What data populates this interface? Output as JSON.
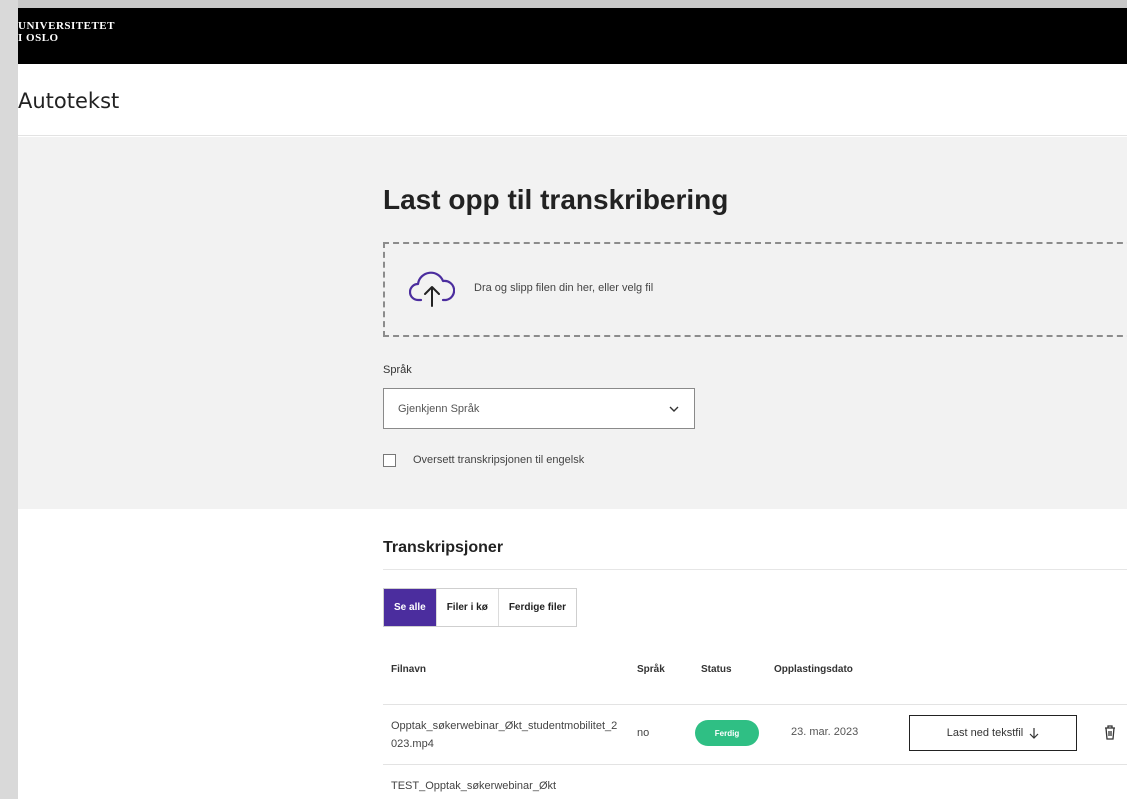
{
  "topbar": {
    "logo_line1": "UNIVERSITETET",
    "logo_line2": "I OSLO"
  },
  "app": {
    "title": "Autotekst"
  },
  "upload": {
    "title": "Last opp til transkribering",
    "dropzone_text": "Dra og slipp filen din her, eller velg fil",
    "language_label": "Språk",
    "language_value": "Gjenkjenn Språk",
    "translate_label": "Oversett transkripsjonen til engelsk",
    "accent_color": "#4b2d9e"
  },
  "transcriptions": {
    "title": "Transkripsjoner",
    "filters": [
      {
        "label": "Se alle",
        "active": true
      },
      {
        "label": "Filer i kø",
        "active": false
      },
      {
        "label": "Ferdige filer",
        "active": false
      }
    ],
    "columns": {
      "filename": "Filnavn",
      "language": "Språk",
      "status": "Status",
      "date": "Opplastingsdato"
    },
    "rows": [
      {
        "filename": "Opptak_søkerwebinar_Økt_studentmobilitet_2023.mp4",
        "language": "no",
        "status": "Ferdig",
        "date": "23. mar. 2023",
        "download_label": "Last ned tekstfil",
        "download_icon": "arrow-down-icon",
        "delete_icon": "trash-icon"
      },
      {
        "filename": "TEST_Opptak_søkerwebinar_Økt",
        "language": "",
        "status": "",
        "date": "",
        "download_label": "",
        "download_icon": "arrow-down-icon",
        "delete_icon": "trash-icon"
      }
    ],
    "status_color": "#2fbf84"
  }
}
